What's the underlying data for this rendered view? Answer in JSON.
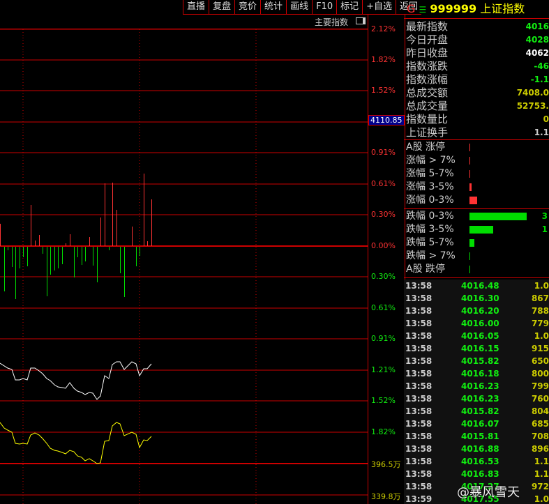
{
  "toolbar": [
    "直播",
    "复盘",
    "竞价",
    "统计",
    "画线",
    "F10",
    "标记",
    "+自选",
    "返回"
  ],
  "chart_header": {
    "label": "主要指数"
  },
  "axis": {
    "upper": [
      {
        "t": "2.12%",
        "c": "#f33"
      },
      {
        "t": "1.82%",
        "c": "#f33"
      },
      {
        "t": "1.52%",
        "c": "#f33"
      },
      {
        "t": "4110.85",
        "c": "#fff",
        "hl": true
      },
      {
        "t": "0.91%",
        "c": "#f33"
      },
      {
        "t": "0.61%",
        "c": "#f33"
      },
      {
        "t": "0.30%",
        "c": "#f33"
      },
      {
        "t": "0.00%",
        "c": "#f33"
      },
      {
        "t": "0.30%",
        "c": "#1e1"
      },
      {
        "t": "0.61%",
        "c": "#1e1"
      },
      {
        "t": "0.91%",
        "c": "#1e1"
      },
      {
        "t": "1.21%",
        "c": "#1e1"
      },
      {
        "t": "1.52%",
        "c": "#1e1"
      },
      {
        "t": "1.82%",
        "c": "#1e1"
      },
      {
        "t": "396.5万",
        "c": "#cc0"
      },
      {
        "t": "339.8万",
        "c": "#cc0"
      }
    ]
  },
  "chart_data": {
    "type": "bar+line",
    "bars_red": [
      [
        0,
        32
      ],
      [
        44,
        59
      ],
      [
        50,
        8
      ],
      [
        56,
        16
      ],
      [
        94,
        4
      ],
      [
        100,
        17
      ],
      [
        128,
        13
      ],
      [
        144,
        41
      ],
      [
        150,
        90
      ],
      [
        161,
        91
      ],
      [
        167,
        52
      ],
      [
        189,
        28
      ],
      [
        206,
        104
      ],
      [
        211,
        7
      ],
      [
        217,
        67
      ]
    ],
    "bars_green": [
      [
        6,
        64
      ],
      [
        11,
        5
      ],
      [
        17,
        29
      ],
      [
        22,
        75
      ],
      [
        28,
        31
      ],
      [
        33,
        15
      ],
      [
        39,
        28
      ],
      [
        61,
        10
      ],
      [
        67,
        71
      ],
      [
        72,
        40
      ],
      [
        78,
        34
      ],
      [
        83,
        31
      ],
      [
        89,
        25
      ],
      [
        106,
        44
      ],
      [
        111,
        15
      ],
      [
        117,
        26
      ],
      [
        122,
        21
      ],
      [
        133,
        27
      ],
      [
        139,
        51
      ],
      [
        156,
        5
      ],
      [
        172,
        38
      ],
      [
        178,
        72
      ],
      [
        195,
        28
      ],
      [
        200,
        13
      ]
    ],
    "white_line": [
      [
        0,
        521
      ],
      [
        11,
        528
      ],
      [
        17,
        530
      ],
      [
        22,
        545
      ],
      [
        28,
        545
      ],
      [
        33,
        543
      ],
      [
        39,
        545
      ],
      [
        44,
        528
      ],
      [
        50,
        528
      ],
      [
        56,
        532
      ],
      [
        61,
        536
      ],
      [
        67,
        543
      ],
      [
        72,
        546
      ],
      [
        78,
        552
      ],
      [
        83,
        555
      ],
      [
        89,
        556
      ],
      [
        94,
        557
      ],
      [
        100,
        549
      ],
      [
        106,
        557
      ],
      [
        111,
        561
      ],
      [
        117,
        563
      ],
      [
        122,
        566
      ],
      [
        128,
        563
      ],
      [
        133,
        564
      ],
      [
        139,
        573
      ],
      [
        144,
        568
      ],
      [
        150,
        539
      ],
      [
        156,
        543
      ],
      [
        161,
        523
      ],
      [
        167,
        519
      ],
      [
        172,
        519
      ],
      [
        178,
        530
      ],
      [
        189,
        519
      ],
      [
        195,
        522
      ],
      [
        200,
        539
      ],
      [
        206,
        529
      ],
      [
        211,
        529
      ],
      [
        217,
        522
      ]
    ],
    "yellow_line": [
      [
        0,
        606
      ],
      [
        6,
        614
      ],
      [
        11,
        617
      ],
      [
        17,
        620
      ],
      [
        22,
        636
      ],
      [
        28,
        637
      ],
      [
        33,
        636
      ],
      [
        39,
        637
      ],
      [
        44,
        624
      ],
      [
        50,
        621
      ],
      [
        56,
        624
      ],
      [
        61,
        629
      ],
      [
        67,
        636
      ],
      [
        72,
        643
      ],
      [
        78,
        646
      ],
      [
        83,
        647
      ],
      [
        89,
        649
      ],
      [
        94,
        651
      ],
      [
        100,
        646
      ],
      [
        106,
        648
      ],
      [
        111,
        654
      ],
      [
        117,
        656
      ],
      [
        122,
        661
      ],
      [
        128,
        658
      ],
      [
        133,
        661
      ],
      [
        139,
        665
      ],
      [
        144,
        664
      ],
      [
        150,
        633
      ],
      [
        156,
        632
      ],
      [
        161,
        611
      ],
      [
        167,
        606
      ],
      [
        172,
        608
      ],
      [
        178,
        625
      ],
      [
        189,
        620
      ],
      [
        195,
        623
      ],
      [
        200,
        642
      ],
      [
        206,
        631
      ],
      [
        211,
        632
      ],
      [
        217,
        626
      ]
    ]
  },
  "quote": {
    "g": "G",
    "menu": "☰",
    "code": "999999",
    "name": "上证指数",
    "rows": [
      {
        "l": "最新指数",
        "v": "4016",
        "c": "#1e1"
      },
      {
        "l": "今日开盘",
        "v": "4028",
        "c": "#1e1"
      },
      {
        "l": "昨日收盘",
        "v": "4062",
        "c": "#fff"
      },
      {
        "l": "指数涨跌",
        "v": "-46",
        "c": "#1e1"
      },
      {
        "l": "指数涨幅",
        "v": "-1.1",
        "c": "#1e1"
      },
      {
        "l": "总成交额",
        "v": "7408.0",
        "c": "#cc0"
      },
      {
        "l": "总成交量",
        "v": "52753.",
        "c": "#cc0"
      },
      {
        "l": "指数量比",
        "v": "0",
        "c": "#cc0"
      },
      {
        "l": "上证换手",
        "v": "1.1",
        "c": "#ccc"
      }
    ]
  },
  "dist_up": [
    {
      "l": "A股 涨停",
      "w": 1
    },
    {
      "l": "涨幅 > 7%",
      "w": 1
    },
    {
      "l": "涨幅 5-7%",
      "w": 1
    },
    {
      "l": "涨幅 3-5%",
      "w": 3
    },
    {
      "l": "涨幅 0-3%",
      "w": 11
    }
  ],
  "dist_down": [
    {
      "l": "跌幅 0-3%",
      "w": 82,
      "n": "3"
    },
    {
      "l": "跌幅 3-5%",
      "w": 34,
      "n": "1"
    },
    {
      "l": "跌幅 5-7%",
      "w": 7,
      "n": ""
    },
    {
      "l": "跌幅 > 7%",
      "w": 1,
      "n": ""
    },
    {
      "l": "A股 跌停",
      "w": 1,
      "n": ""
    }
  ],
  "ticks": [
    [
      "13:58",
      "4016.48",
      "1.0"
    ],
    [
      "13:58",
      "4016.30",
      "867"
    ],
    [
      "13:58",
      "4016.20",
      "788"
    ],
    [
      "13:58",
      "4016.00",
      "779"
    ],
    [
      "13:58",
      "4016.05",
      "1.0"
    ],
    [
      "13:58",
      "4016.15",
      "915"
    ],
    [
      "13:58",
      "4015.82",
      "650"
    ],
    [
      "13:58",
      "4016.18",
      "800"
    ],
    [
      "13:58",
      "4016.23",
      "799"
    ],
    [
      "13:58",
      "4016.23",
      "760"
    ],
    [
      "13:58",
      "4015.82",
      "804"
    ],
    [
      "13:58",
      "4016.07",
      "685"
    ],
    [
      "13:58",
      "4015.81",
      "708"
    ],
    [
      "13:58",
      "4016.88",
      "896"
    ],
    [
      "13:58",
      "4016.53",
      "1.1"
    ],
    [
      "13:58",
      "4016.83",
      "1.1"
    ],
    [
      "13:58",
      "4017.27",
      "972"
    ],
    [
      "13:59",
      "4017.55",
      "1.0"
    ]
  ],
  "watermark": "@暴风雪天"
}
